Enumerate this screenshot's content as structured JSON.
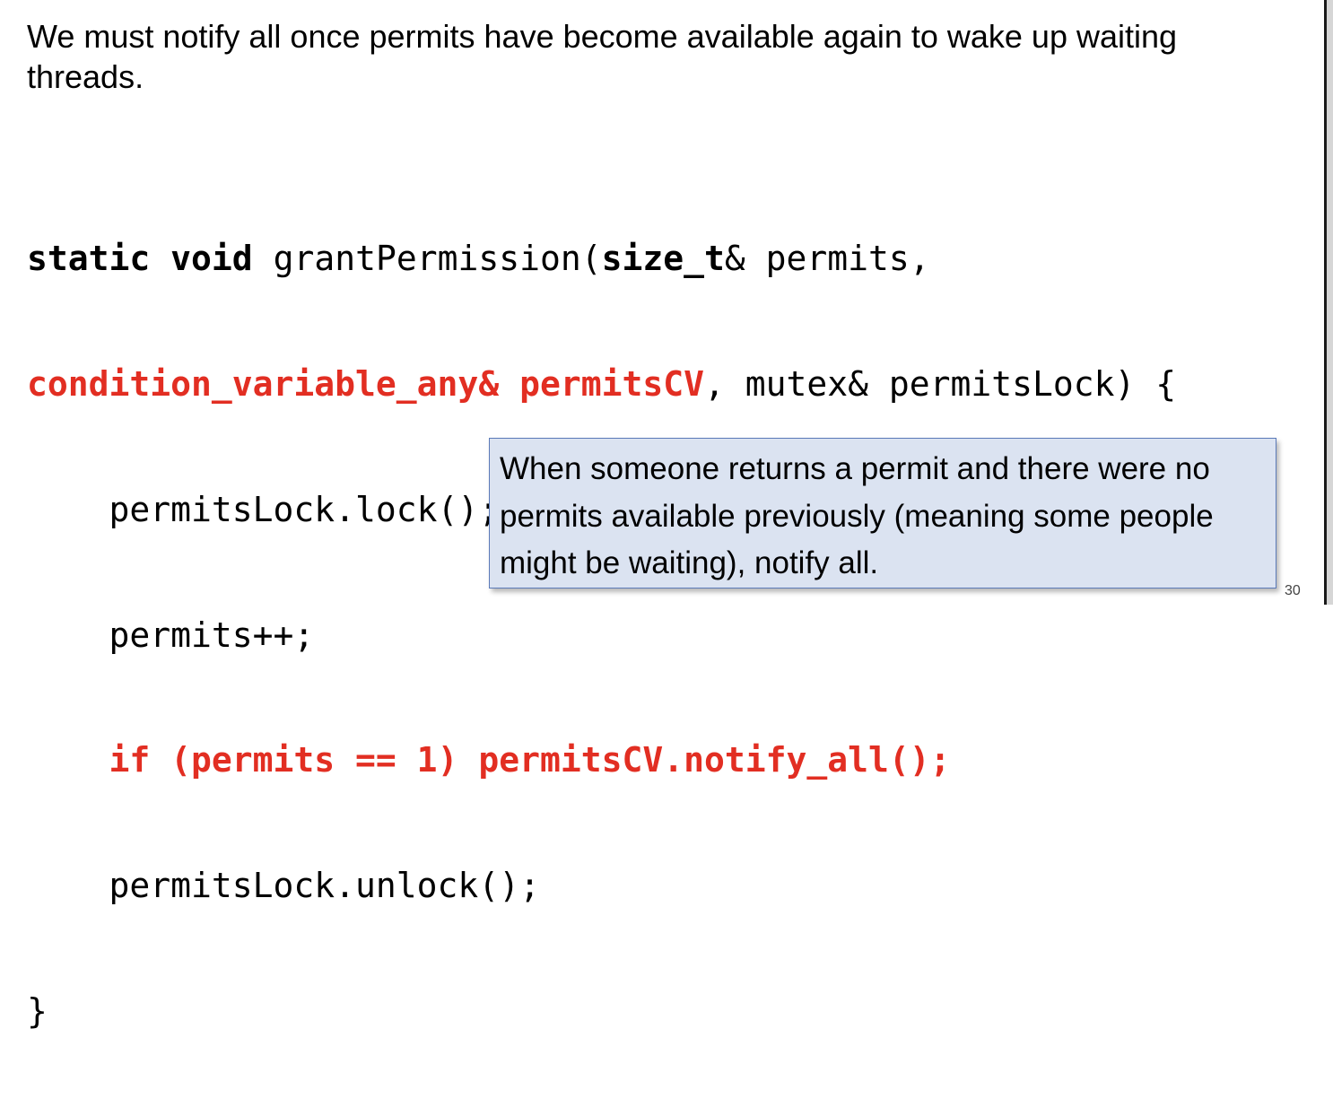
{
  "slide": {
    "intro_text": "We must notify all once permits have become available again to wake up waiting threads.",
    "code": {
      "l1_kw_static": "static",
      "l1_kw_void": "void",
      "l1_name": "grantPermission(",
      "l1_kw_size_t": "size_t",
      "l1_rest": "& permits,",
      "l2_red": "condition_variable_any& permitsCV",
      "l2_rest": ", mutex& permitsLock) {",
      "l3": "    permitsLock.lock();",
      "l4": "    permits++;",
      "l5_red": "if (permits == 1) permitsCV.notify_all();",
      "l6": "    permitsLock.unlock();",
      "l7": "}"
    },
    "callout_text": "When someone returns a permit and there were no permits available previously (meaning some people might be waiting), notify all.",
    "page_number": "30"
  },
  "colors": {
    "highlight_red": "#e22e22",
    "callout_fill": "#dbe3f1",
    "callout_border": "#5b7ab8"
  }
}
